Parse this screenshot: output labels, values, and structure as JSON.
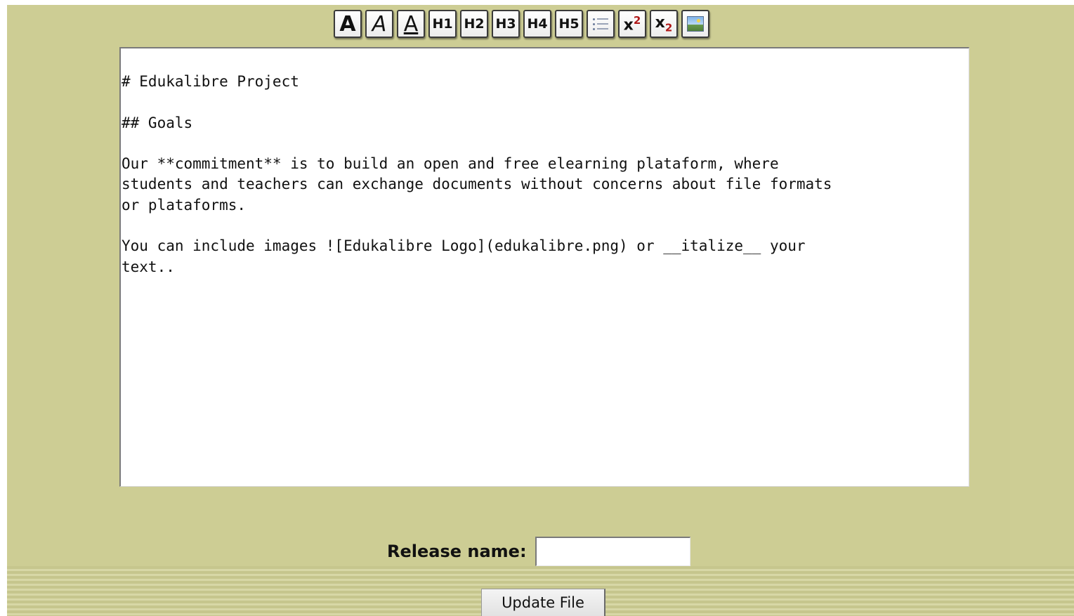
{
  "toolbar": {
    "buttons": [
      {
        "name": "bold-button",
        "icon": "bold-icon",
        "label": "A"
      },
      {
        "name": "italic-button",
        "icon": "italic-icon",
        "label": "A"
      },
      {
        "name": "underline-button",
        "icon": "underline-icon",
        "label": "A"
      },
      {
        "name": "h1-button",
        "label": "H1"
      },
      {
        "name": "h2-button",
        "label": "H2"
      },
      {
        "name": "h3-button",
        "label": "H3"
      },
      {
        "name": "h4-button",
        "label": "H4"
      },
      {
        "name": "h5-button",
        "label": "H5"
      },
      {
        "name": "list-button",
        "icon": "bulleted-list-icon"
      },
      {
        "name": "superscript-button",
        "label": "x",
        "script": "2"
      },
      {
        "name": "subscript-button",
        "label": "x",
        "script": "2"
      },
      {
        "name": "insert-image-button",
        "icon": "image-icon"
      }
    ]
  },
  "editor": {
    "lines": [
      "# Edukalibre Project",
      "",
      "## Goals",
      "",
      "Our **commitment** is to build an open and free elearning plataform, where",
      "students and teachers can exchange documents without concerns about file formats",
      "or plataforms.",
      "",
      "You can include images ![Edukalibre Logo](edukalibre.png) or __italize__ your",
      "text.."
    ]
  },
  "release": {
    "label": "Release name:",
    "value": ""
  },
  "actions": {
    "update_label": "Update File"
  },
  "colors": {
    "page_background": "#cdcd94",
    "stripe_dark": "#c6c68d",
    "stripe_light": "#d7d7a6",
    "superscript_accent": "#b01818"
  }
}
